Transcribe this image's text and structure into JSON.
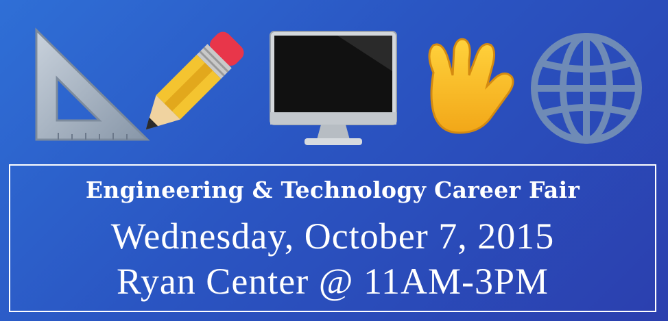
{
  "icons": [
    "triangle-ruler-icon",
    "pencil-icon",
    "desktop-computer-icon",
    "vulcan-salute-icon",
    "globe-icon"
  ],
  "event": {
    "title": "Engineering & Technology Career Fair",
    "date": "Wednesday, October 7, 2015",
    "location_time": "Ryan Center @ 11AM-3PM"
  },
  "colors": {
    "background": "#2a55c2",
    "text": "#ffffff",
    "border": "#ffffff"
  }
}
